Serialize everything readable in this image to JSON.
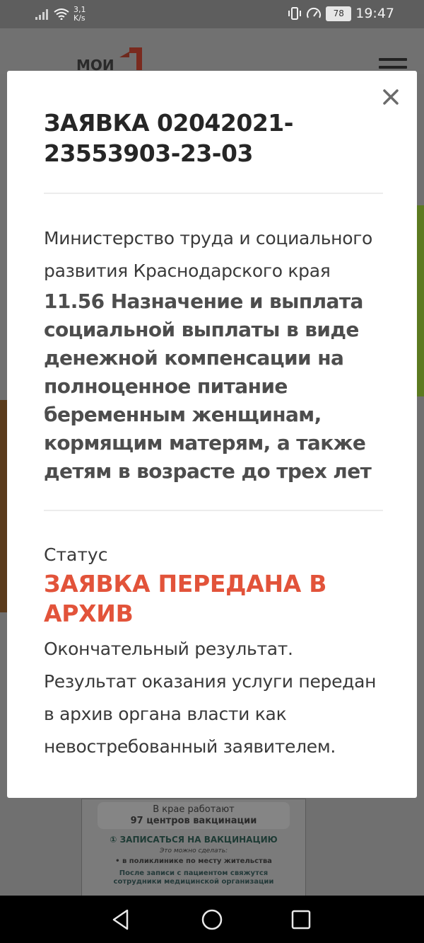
{
  "status_bar": {
    "network_speed_value": "3,1",
    "network_speed_unit": "K/s",
    "battery_level": "78",
    "time": "19:47"
  },
  "background": {
    "logo_text": "МОИ",
    "banner": {
      "line1": "В крае работают",
      "line2": "97 центров вакцинации",
      "signup": "① ЗАПИСАТЬСЯ НА ВАКЦИНАЦИЮ",
      "can_do": "Это можно сделать:",
      "bullet": "• в поликлинике по месту жительства",
      "after_1": "После записи с пациентом свяжутся",
      "after_2": "сотрудники медицинской организации"
    }
  },
  "modal": {
    "title": "ЗАЯВКА 02042021-23553903-23-03",
    "ministry": "Министерство труда и социального развития Краснодарского края",
    "service": "11.56 Назначение и выплата социальной выплаты в виде денежной компенсации на полноценное питание беременным женщинам, кормящим матерям, а также детям в возрасте до трех лет",
    "status_label": "Статус",
    "status_value": "ЗАЯВКА ПЕРЕДАНА В АРХИВ",
    "status_description": "Окончательный результат. Результат оказания услуги передан в архив органа власти как невостребованный заявителем.",
    "close_icon": "close-icon"
  },
  "colors": {
    "status_accent": "#e2533a",
    "overlay": "#707070"
  }
}
